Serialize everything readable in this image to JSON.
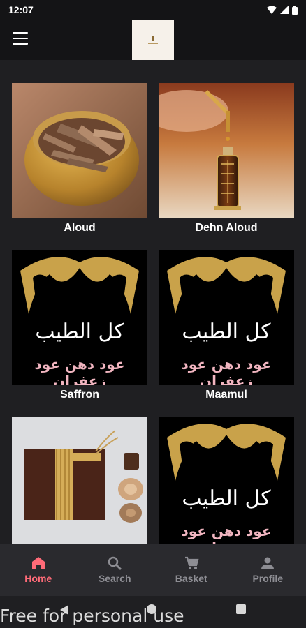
{
  "status_bar": {
    "time": "12:07"
  },
  "header": {
    "logo": "app-logo"
  },
  "products": [
    {
      "name": "Aloud",
      "image": "agarwood-bowl"
    },
    {
      "name": "Dehn Aloud",
      "image": "oud-oil-bottle"
    },
    {
      "name": "Saffron",
      "image": "brand-image"
    },
    {
      "name": "Maamul",
      "image": "brand-image"
    },
    {
      "name": "",
      "image": "wrapped-fabric-and-wood"
    },
    {
      "name": "",
      "image": "brand-image"
    }
  ],
  "brand_image": {
    "line1": "كل الطيب",
    "line2": "عود دهن عود زعفران"
  },
  "bottom_nav": [
    {
      "label": "Home",
      "icon": "home-icon",
      "active": true
    },
    {
      "label": "Search",
      "icon": "search-icon"
    },
    {
      "label": "Basket",
      "icon": "cart-icon"
    },
    {
      "label": "Profile",
      "icon": "person-icon"
    }
  ],
  "watermark": "Free for personal use",
  "colors": {
    "accent": "#ff6b78",
    "background": "#1f1f22",
    "nav_inactive": "#8d8d93",
    "gold": "#c9a24a"
  }
}
